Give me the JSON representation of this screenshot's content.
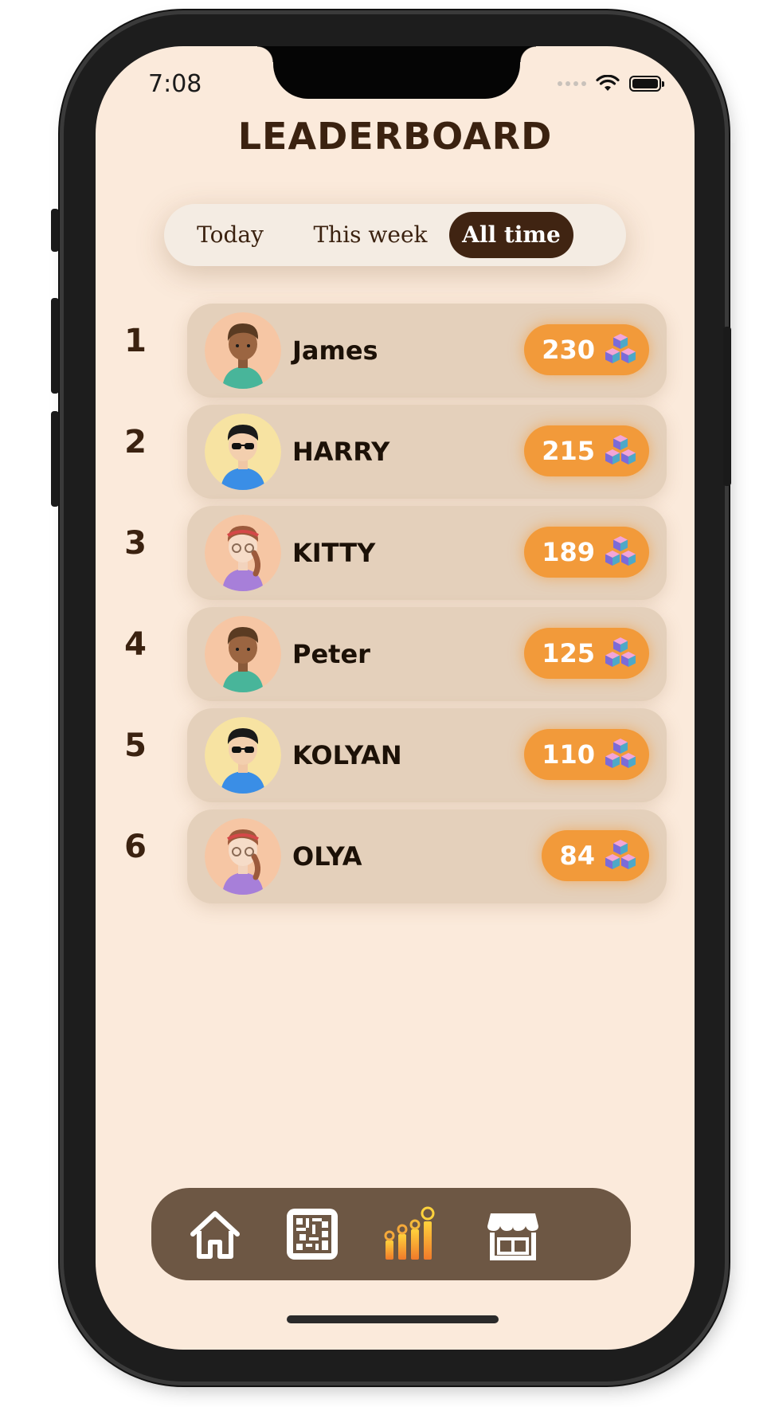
{
  "status": {
    "time": "7:08"
  },
  "title": "LEADERBOARD",
  "tabs": [
    {
      "label": "Today",
      "active": false
    },
    {
      "label": "This week",
      "active": false
    },
    {
      "label": "All time",
      "active": true
    }
  ],
  "leaderboard": [
    {
      "rank": "1",
      "name": "James",
      "score": "230",
      "avatar": "boy-avatar"
    },
    {
      "rank": "2",
      "name": "HARRY",
      "score": "215",
      "avatar": "sunglasses-avatar"
    },
    {
      "rank": "3",
      "name": "KITTY",
      "score": "189",
      "avatar": "girl-avatar"
    },
    {
      "rank": "4",
      "name": "Peter",
      "score": "125",
      "avatar": "boy-avatar"
    },
    {
      "rank": "5",
      "name": "KOLYAN",
      "score": "110",
      "avatar": "sunglasses-avatar"
    },
    {
      "rank": "6",
      "name": "OLYA",
      "score": "84",
      "avatar": "girl-avatar"
    }
  ],
  "score_icon": "cubes-icon",
  "nav": [
    {
      "icon": "home-icon",
      "active": false
    },
    {
      "icon": "qr-code-icon",
      "active": false
    },
    {
      "icon": "leaderboard-icon",
      "active": true
    },
    {
      "icon": "shop-icon",
      "active": false
    }
  ],
  "colors": {
    "background": "#fbeadb",
    "primary_dark": "#402412",
    "score_badge": "#f29a3a",
    "row": "#e4d0bb",
    "navbar": "#6d5744"
  }
}
